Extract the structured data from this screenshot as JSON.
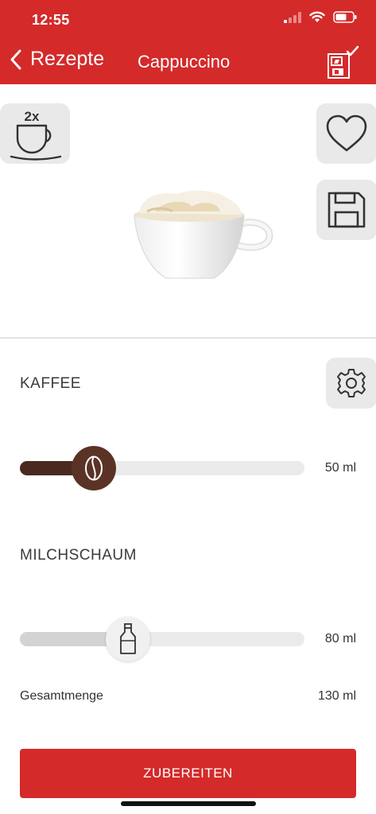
{
  "status": {
    "time": "12:55"
  },
  "nav": {
    "back_label": "Rezepte",
    "title": "Cappuccino"
  },
  "portion": {
    "label": "2x"
  },
  "ingredients": {
    "coffee": {
      "label": "KAFFEE",
      "value": "50 ml",
      "level": 0.26,
      "fill_color": "#4a2a20",
      "thumb_color": "#5a3326",
      "icon": "coffee-bean-icon"
    },
    "milk_foam": {
      "label": "MILCHSCHAUM",
      "value": "80 ml",
      "level": 0.38,
      "fill_color": "#d3d3d3",
      "thumb_color": "#f0f0f0",
      "icon": "milk-bottle-icon"
    }
  },
  "total": {
    "label": "Gesamtmenge",
    "value": "130 ml"
  },
  "cta": {
    "label": "ZUBEREITEN"
  },
  "colors": {
    "brand": "#d42a2a",
    "tile": "#e9e9e9",
    "track": "#ebebeb"
  }
}
